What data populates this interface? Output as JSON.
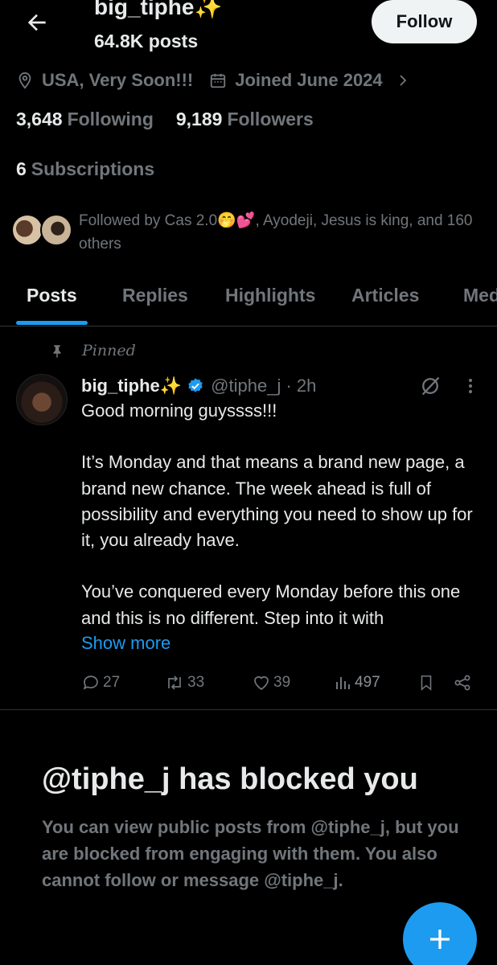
{
  "header": {
    "name": "big_tiphe✨",
    "posts_count": "64.8K posts",
    "follow_label": "Follow"
  },
  "profile": {
    "location": "USA, Very Soon!!!",
    "joined": "Joined June 2024",
    "following_count": "3,648",
    "following_label": "Following",
    "followers_count": "9,189",
    "followers_label": "Followers",
    "subscriptions_count": "6",
    "subscriptions_label": "Subscriptions",
    "followed_by": "Followed by Cas 2.0🤭💕, Ayodeji, Jesus is king, and 160 others"
  },
  "tabs": [
    "Posts",
    "Replies",
    "Highlights",
    "Articles",
    "Media"
  ],
  "active_tab": "Posts",
  "pinned_post": {
    "pinned_label": "Pinned",
    "author_name": "big_tiphe✨",
    "author_handle": "@tiphe_j · 2h",
    "text_lines": [
      "Good morning guyssss!!!",
      "It’s Monday and that means a brand new page, a brand new chance. The week ahead is full of possibility and everything you need to show up for it, you already have.",
      "You’ve conquered every Monday before this one and this is no different. Step into it with"
    ],
    "show_more": "Show more",
    "replies": "27",
    "reposts": "33",
    "likes": "39",
    "views": "497"
  },
  "blocked": {
    "title": "@tiphe_j has blocked you",
    "description": "You can view public posts from @tiphe_j, but you are blocked from engaging with them. You also cannot follow or message @tiphe_j."
  },
  "colors": {
    "background": "#000000",
    "text_primary": "#e7e9ea",
    "text_secondary": "#71767b",
    "accent": "#1d9bf0",
    "divider": "#2f3336"
  }
}
